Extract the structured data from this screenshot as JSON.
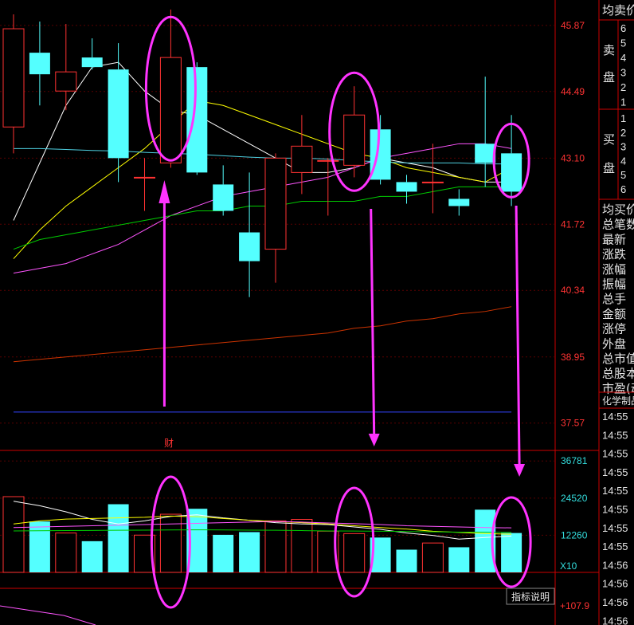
{
  "colors": {
    "up": "#ff3232",
    "down": "#54ffff",
    "annotation": "#ff33ff",
    "ma5": "#ffffff",
    "ma10": "#ffff00",
    "ma20": "#ff55ff",
    "ma30": "#00cc00",
    "ma60": "#cc3300",
    "ma120": "#3344ff",
    "axis": "#cc0000"
  },
  "chart_data": [
    {
      "type": "candlestick",
      "name": "price",
      "ylim": [
        37.0,
        46.4
      ],
      "y_ticks": [
        45.87,
        44.49,
        43.1,
        41.72,
        40.34,
        38.95,
        37.57
      ],
      "candles": [
        {
          "o": 43.75,
          "h": 46.1,
          "l": 43.2,
          "c": 45.8
        },
        {
          "o": 45.3,
          "h": 45.95,
          "l": 44.2,
          "c": 44.85
        },
        {
          "o": 44.5,
          "h": 45.9,
          "l": 44.1,
          "c": 44.9
        },
        {
          "o": 45.2,
          "h": 45.6,
          "l": 44.95,
          "c": 45.0
        },
        {
          "o": 44.95,
          "h": 45.5,
          "l": 42.6,
          "c": 43.1
        },
        {
          "o": 42.7,
          "h": 43.1,
          "l": 42.0,
          "c": 42.7
        },
        {
          "o": 43.0,
          "h": 46.2,
          "l": 42.9,
          "c": 45.2
        },
        {
          "o": 45.0,
          "h": 45.1,
          "l": 42.75,
          "c": 42.8
        },
        {
          "o": 42.55,
          "h": 42.95,
          "l": 41.9,
          "c": 42.0
        },
        {
          "o": 41.55,
          "h": 42.8,
          "l": 40.2,
          "c": 40.95
        },
        {
          "o": 41.2,
          "h": 43.2,
          "l": 40.5,
          "c": 43.1
        },
        {
          "o": 42.8,
          "h": 44.0,
          "l": 42.35,
          "c": 43.35
        },
        {
          "o": 43.05,
          "h": 43.1,
          "l": 41.9,
          "c": 43.05
        },
        {
          "o": 42.95,
          "h": 44.6,
          "l": 42.7,
          "c": 44.0
        },
        {
          "o": 43.7,
          "h": 44.0,
          "l": 42.55,
          "c": 42.65
        },
        {
          "o": 42.6,
          "h": 42.75,
          "l": 42.15,
          "c": 42.4
        },
        {
          "o": 42.6,
          "h": 43.4,
          "l": 41.95,
          "c": 42.6
        },
        {
          "o": 42.25,
          "h": 42.45,
          "l": 41.9,
          "c": 42.1
        },
        {
          "o": 43.4,
          "h": 44.8,
          "l": 42.5,
          "c": 43.0
        },
        {
          "o": 43.2,
          "h": 44.0,
          "l": 42.1,
          "c": 42.4
        }
      ],
      "ma": [
        {
          "name": "ma5",
          "color": "#ffffff",
          "values": [
            41.8,
            43.0,
            44.2,
            45.0,
            45.1,
            44.5,
            44.1,
            44.0,
            43.7,
            43.4,
            43.1,
            42.8,
            42.8,
            42.9,
            43.1,
            43.0,
            42.9,
            42.7,
            42.6,
            42.6
          ]
        },
        {
          "name": "ma10",
          "color": "#ffff00",
          "values": [
            41.0,
            41.6,
            42.1,
            42.5,
            42.9,
            43.3,
            43.8,
            44.3,
            44.2,
            44.0,
            43.8,
            43.6,
            43.4,
            43.2,
            43.1,
            42.9,
            42.8,
            42.7,
            42.6,
            42.9
          ]
        },
        {
          "name": "ma20",
          "color": "#ff55ff",
          "values": [
            40.7,
            40.8,
            40.9,
            41.1,
            41.3,
            41.6,
            41.9,
            42.1,
            42.3,
            42.4,
            42.5,
            42.6,
            42.7,
            42.9,
            43.1,
            43.2,
            43.3,
            43.4,
            43.4,
            43.3
          ]
        },
        {
          "name": "ma30",
          "color": "#00cc00",
          "values": [
            41.2,
            41.4,
            41.5,
            41.6,
            41.7,
            41.8,
            41.9,
            42.0,
            42.0,
            42.1,
            42.1,
            42.2,
            42.2,
            42.2,
            42.3,
            42.3,
            42.4,
            42.5,
            42.5,
            42.5
          ]
        },
        {
          "name": "ma60",
          "color": "#cc3300",
          "values": [
            38.85,
            38.9,
            38.95,
            39.0,
            39.05,
            39.1,
            39.15,
            39.2,
            39.25,
            39.3,
            39.35,
            39.4,
            39.45,
            39.55,
            39.6,
            39.7,
            39.75,
            39.85,
            39.9,
            40.0
          ]
        },
        {
          "name": "ma120",
          "color": "#3344ff",
          "values": [
            37.8,
            37.8,
            37.8,
            37.8,
            37.8,
            37.8,
            37.8,
            37.8,
            37.8,
            37.8,
            37.8,
            37.8,
            37.8,
            37.8,
            37.8,
            37.8,
            37.8,
            37.8,
            37.8,
            37.8
          ]
        },
        {
          "name": "ma250",
          "color": "#4ecfe0",
          "values": [
            43.3,
            43.3,
            43.28,
            43.26,
            43.25,
            43.22,
            43.2,
            43.18,
            43.15,
            43.12,
            43.1,
            43.1,
            43.08,
            43.05,
            43.02,
            43.0,
            43.0,
            43.0,
            42.98,
            42.98
          ]
        }
      ],
      "annotations": {
        "event_marker": "财",
        "ellipses_on_candles": [
          6,
          13,
          19
        ],
        "up_arrow_at": 6,
        "down_arrows_at": [
          13,
          19
        ]
      }
    },
    {
      "type": "bar",
      "name": "volume",
      "ylim": [
        0,
        40000
      ],
      "y_ticks": [
        36781,
        24520,
        12260
      ],
      "unit_label": "X10",
      "values": [
        25000,
        16800,
        13000,
        10300,
        22500,
        12300,
        19200,
        21000,
        12400,
        13300,
        17000,
        17500,
        13600,
        12800,
        11500,
        7500,
        9700,
        8300,
        20700,
        13000
      ],
      "ma": [
        {
          "name": "vma5",
          "color": "#ffffff",
          "values": [
            23500,
            22000,
            20000,
            17500,
            16000,
            17000,
            18500,
            19000,
            18000,
            17200,
            16400,
            16000,
            15800,
            15000,
            14200,
            13000,
            12200,
            11000,
            11500,
            12000
          ]
        },
        {
          "name": "vma10",
          "color": "#ffff00",
          "values": [
            16000,
            17000,
            17600,
            17800,
            18000,
            18200,
            18600,
            18400,
            17800,
            17200,
            16800,
            16400,
            16000,
            15400,
            14800,
            14300,
            13600,
            13200,
            12800,
            12600
          ]
        },
        {
          "name": "vma20",
          "color": "#ff55ff",
          "values": [
            14800,
            15000,
            15200,
            15400,
            15600,
            15800,
            16000,
            16200,
            16400,
            16600,
            16800,
            16600,
            16300,
            16100,
            15800,
            15400,
            15200,
            15000,
            14800,
            14700
          ]
        },
        {
          "name": "vma30",
          "color": "#00cc00",
          "values": [
            13700,
            13750,
            13800,
            13850,
            13900,
            13950,
            14000,
            14050,
            14000,
            13950,
            13900,
            13800,
            13700,
            13650,
            13600,
            13500,
            13400,
            13300,
            13250,
            13200
          ]
        }
      ]
    }
  ],
  "indicator": {
    "button_label": "指标说明",
    "value": "+107.9"
  },
  "side_panel": {
    "header": "均卖价",
    "sell_label_1": "卖",
    "sell_label_2": "盘",
    "sell_levels": [
      "6",
      "5",
      "4",
      "3",
      "2",
      "1"
    ],
    "buy_label_1": "买",
    "buy_label_2": "盘",
    "buy_levels": [
      "1",
      "2",
      "3",
      "4",
      "5",
      "6"
    ],
    "stats": [
      "均买价",
      "总笔数",
      "最新",
      "涨跌",
      "涨幅",
      "振幅",
      "总手",
      "金额",
      "涨停",
      "外盘",
      "总市值",
      "总股本",
      "市盈(动"
    ],
    "industry": "化学制品",
    "times": [
      "14:55",
      "14:55",
      "14:55",
      "14:55",
      "14:55",
      "14:55",
      "14:55",
      "14:55",
      "14:56",
      "14:56",
      "14:56",
      "14:56",
      "14:56"
    ]
  }
}
